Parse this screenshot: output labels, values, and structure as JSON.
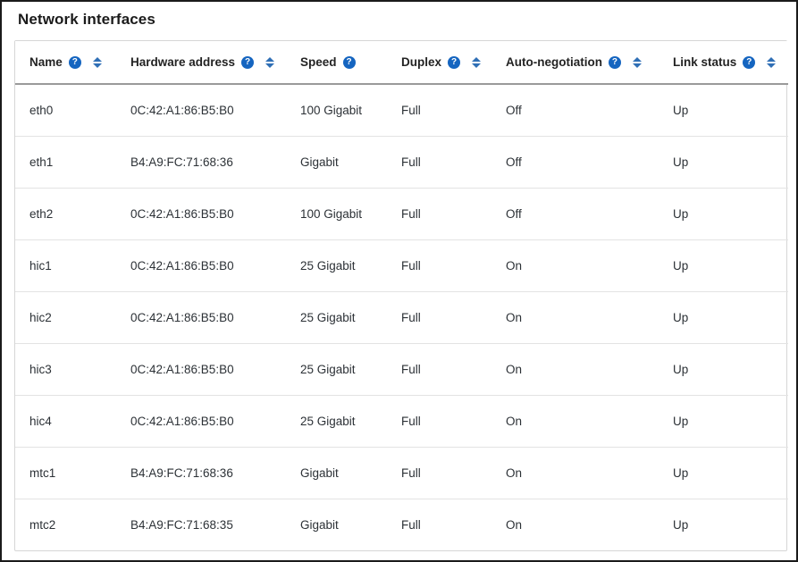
{
  "page": {
    "title": "Network interfaces"
  },
  "table": {
    "columns": [
      {
        "label": "Name",
        "help": "?",
        "has_help": true,
        "has_sort": true,
        "help_icon": "help-circle-icon",
        "sort_icon": "sort-arrows-icon"
      },
      {
        "label": "Hardware address",
        "help": "?",
        "has_help": true,
        "has_sort": true,
        "help_icon": "help-circle-icon",
        "sort_icon": "sort-arrows-icon"
      },
      {
        "label": "Speed",
        "help": "?",
        "has_help": true,
        "has_sort": false,
        "help_icon": "help-circle-icon",
        "sort_icon": ""
      },
      {
        "label": "Duplex",
        "help": "?",
        "has_help": true,
        "has_sort": true,
        "help_icon": "help-circle-icon",
        "sort_icon": "sort-arrows-icon"
      },
      {
        "label": "Auto-negotiation",
        "help": "?",
        "has_help": true,
        "has_sort": true,
        "help_icon": "help-circle-icon",
        "sort_icon": "sort-arrows-icon"
      },
      {
        "label": "Link status",
        "help": "?",
        "has_help": true,
        "has_sort": true,
        "help_icon": "help-circle-icon",
        "sort_icon": "sort-arrows-icon"
      }
    ],
    "rows": [
      {
        "name": "eth0",
        "hardware_address": "0C:42:A1:86:B5:B0",
        "speed": "100 Gigabit",
        "duplex": "Full",
        "auto_negotiation": "Off",
        "link_status": "Up"
      },
      {
        "name": "eth1",
        "hardware_address": "B4:A9:FC:71:68:36",
        "speed": "Gigabit",
        "duplex": "Full",
        "auto_negotiation": "Off",
        "link_status": "Up"
      },
      {
        "name": "eth2",
        "hardware_address": "0C:42:A1:86:B5:B0",
        "speed": "100 Gigabit",
        "duplex": "Full",
        "auto_negotiation": "Off",
        "link_status": "Up"
      },
      {
        "name": "hic1",
        "hardware_address": "0C:42:A1:86:B5:B0",
        "speed": "25 Gigabit",
        "duplex": "Full",
        "auto_negotiation": "On",
        "link_status": "Up"
      },
      {
        "name": "hic2",
        "hardware_address": "0C:42:A1:86:B5:B0",
        "speed": "25 Gigabit",
        "duplex": "Full",
        "auto_negotiation": "On",
        "link_status": "Up"
      },
      {
        "name": "hic3",
        "hardware_address": "0C:42:A1:86:B5:B0",
        "speed": "25 Gigabit",
        "duplex": "Full",
        "auto_negotiation": "On",
        "link_status": "Up"
      },
      {
        "name": "hic4",
        "hardware_address": "0C:42:A1:86:B5:B0",
        "speed": "25 Gigabit",
        "duplex": "Full",
        "auto_negotiation": "On",
        "link_status": "Up"
      },
      {
        "name": "mtc1",
        "hardware_address": "B4:A9:FC:71:68:36",
        "speed": "Gigabit",
        "duplex": "Full",
        "auto_negotiation": "On",
        "link_status": "Up"
      },
      {
        "name": "mtc2",
        "hardware_address": "B4:A9:FC:71:68:35",
        "speed": "Gigabit",
        "duplex": "Full",
        "auto_negotiation": "On",
        "link_status": "Up"
      }
    ]
  },
  "colors": {
    "accent_blue": "#1565c0",
    "sort_blue": "#2f6fb5",
    "text": "#2c3136",
    "header_text": "#232323",
    "border": "#d6d6d6",
    "row_divider": "#e3e3e3",
    "header_divider": "#9a9a9a"
  }
}
